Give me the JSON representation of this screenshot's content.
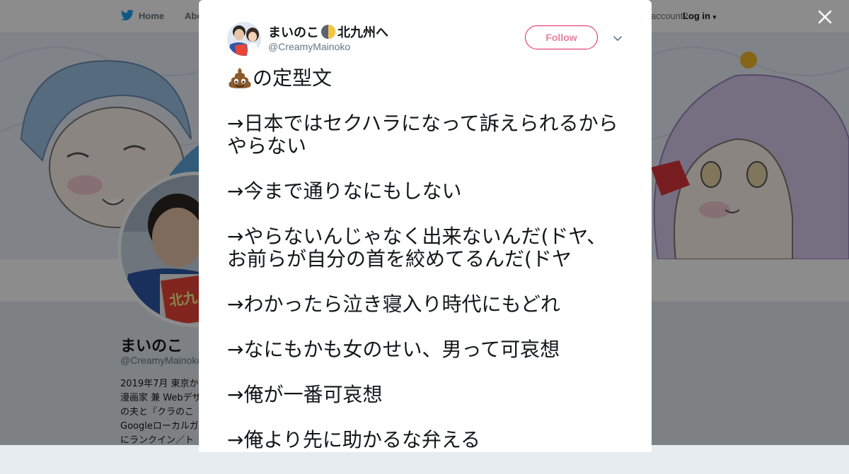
{
  "nav": {
    "home_label": "Home",
    "about_label": "Abo",
    "account_label": "account?",
    "login_label": "Log in"
  },
  "profile": {
    "name": "まいのこ",
    "handle": "@CreamyMainoko",
    "bio": "2019年7月 東京か\n漫画家 兼 Webデザ\nの夫と『クラのこ\nGoogleローカルガ\nにランクイン／ト"
  },
  "tweet": {
    "author_name": "まいのこ",
    "author_name_suffix": "北九州へ",
    "author_handle": "@CreamyMainoko",
    "follow_label": "Follow",
    "lead_emoji": "pile-of-poo-emoji",
    "first_line": "の定型文",
    "lines": [
      "→日本ではセクハラになって訴えられるからやらない",
      "→今まで通りなにもしない",
      "→やらないんじゃなく出来ないんだ(ドヤ、お前らが自分の首を絞めてるんだ(ドヤ",
      "→わかったら泣き寝入り時代にもどれ",
      "→なにもかも女のせい、男って可哀想",
      "→俺が一番可哀想",
      "→俺より先に助かるな弁える"
    ]
  },
  "icons": {
    "bird": "twitter-bird-icon",
    "moon": "half-moon-icon",
    "close": "close-icon",
    "chevron": "chevron-down-icon"
  },
  "colors": {
    "follow_border": "#e0245e",
    "follow_text": "#e8809e",
    "twitter_blue": "#1da1f2",
    "overlay": "rgba(0,0,0,0.45)"
  }
}
